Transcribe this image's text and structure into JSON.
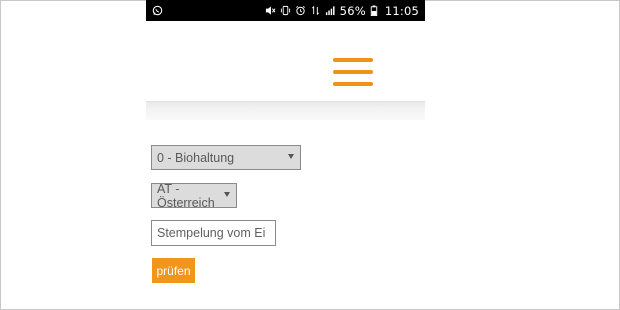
{
  "status_bar": {
    "left_icon": "whatsapp-icon",
    "right_icons": [
      "mute-icon",
      "vibrate-icon",
      "alarm-icon",
      "data-arrows-icon",
      "signal-icon",
      "battery-icon"
    ],
    "battery_percent": "56%",
    "time": "11:05"
  },
  "header": {
    "menu_icon": "hamburger-menu-icon",
    "accent_color": "#ee9315"
  },
  "form": {
    "production_select": {
      "selected": "0 - Biohaltung"
    },
    "country_select": {
      "selected": "AT - Österreich"
    },
    "stamp_input": {
      "placeholder": "Stempelung vom Ei",
      "value": ""
    },
    "submit_label": "prüfen",
    "button_color": "#f2951b"
  }
}
